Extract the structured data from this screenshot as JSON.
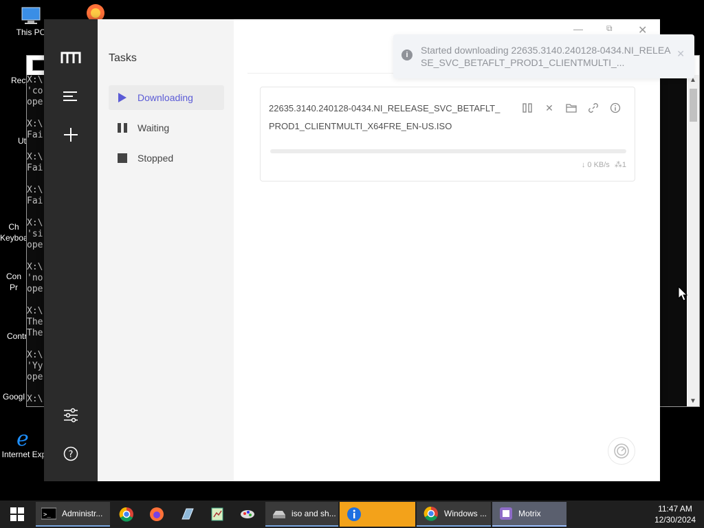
{
  "desktop": {
    "icons": [
      {
        "label": "This PC"
      },
      {
        "label": "Recy"
      },
      {
        "label": "Ut"
      },
      {
        "label": "Ch\nKeyboa"
      },
      {
        "label": "Con\nPr"
      },
      {
        "label": "Contr"
      },
      {
        "label": "Googl"
      },
      {
        "label": "Internet Exp"
      }
    ]
  },
  "console": {
    "lines": [
      "X:\\",
      "'co",
      "ope",
      "",
      "X:\\",
      "Fai",
      "",
      "X:\\",
      "Fai",
      "",
      "X:\\",
      "Fai",
      "",
      "X:\\",
      "'si",
      "ope",
      "",
      "X:\\",
      "'no",
      "ope",
      "",
      "X:\\",
      "The",
      "The",
      "",
      "X:\\",
      "'Yy",
      "ope",
      "",
      "X:\\"
    ]
  },
  "motrix": {
    "aside_title": "Tasks",
    "menu": [
      {
        "label": "Downloading",
        "icon": "play-icon",
        "active": true
      },
      {
        "label": "Waiting",
        "icon": "pause-icon",
        "active": false
      },
      {
        "label": "Stopped",
        "icon": "stop-icon",
        "active": false
      }
    ],
    "toast": {
      "message": "Started downloading 22635.3140.240128-0434.NI_RELEASE_SVC_BETAFLT_PROD1_CLIENTMULTI_..."
    },
    "task": {
      "name": "22635.3140.240128-0434.NI_RELEASE_SVC_BETAFLT_PROD1_CLIENTMULTI_X64FRE_EN-US.ISO",
      "speed": "↓ 0 KB/s",
      "connections": "1",
      "progress": 0
    },
    "accent": "#5b5bd6"
  },
  "taskbar": {
    "items": [
      {
        "label": "Administr...",
        "icon": "cmd-icon"
      },
      {
        "label": "",
        "icon": "chrome-icon"
      },
      {
        "label": "",
        "icon": "firefox-icon"
      },
      {
        "label": "",
        "icon": "app-icon"
      },
      {
        "label": "",
        "icon": "notepad-icon"
      },
      {
        "label": "",
        "icon": "paint-icon"
      },
      {
        "label": "iso and sh...",
        "icon": "drive-icon"
      },
      {
        "label": "",
        "icon": "info-icon"
      },
      {
        "label": "Windows ...",
        "icon": "chrome-icon"
      },
      {
        "label": "Motrix",
        "icon": "motrix-icon"
      }
    ],
    "clock_time": "11:47 AM",
    "clock_date": "12/30/2024"
  }
}
